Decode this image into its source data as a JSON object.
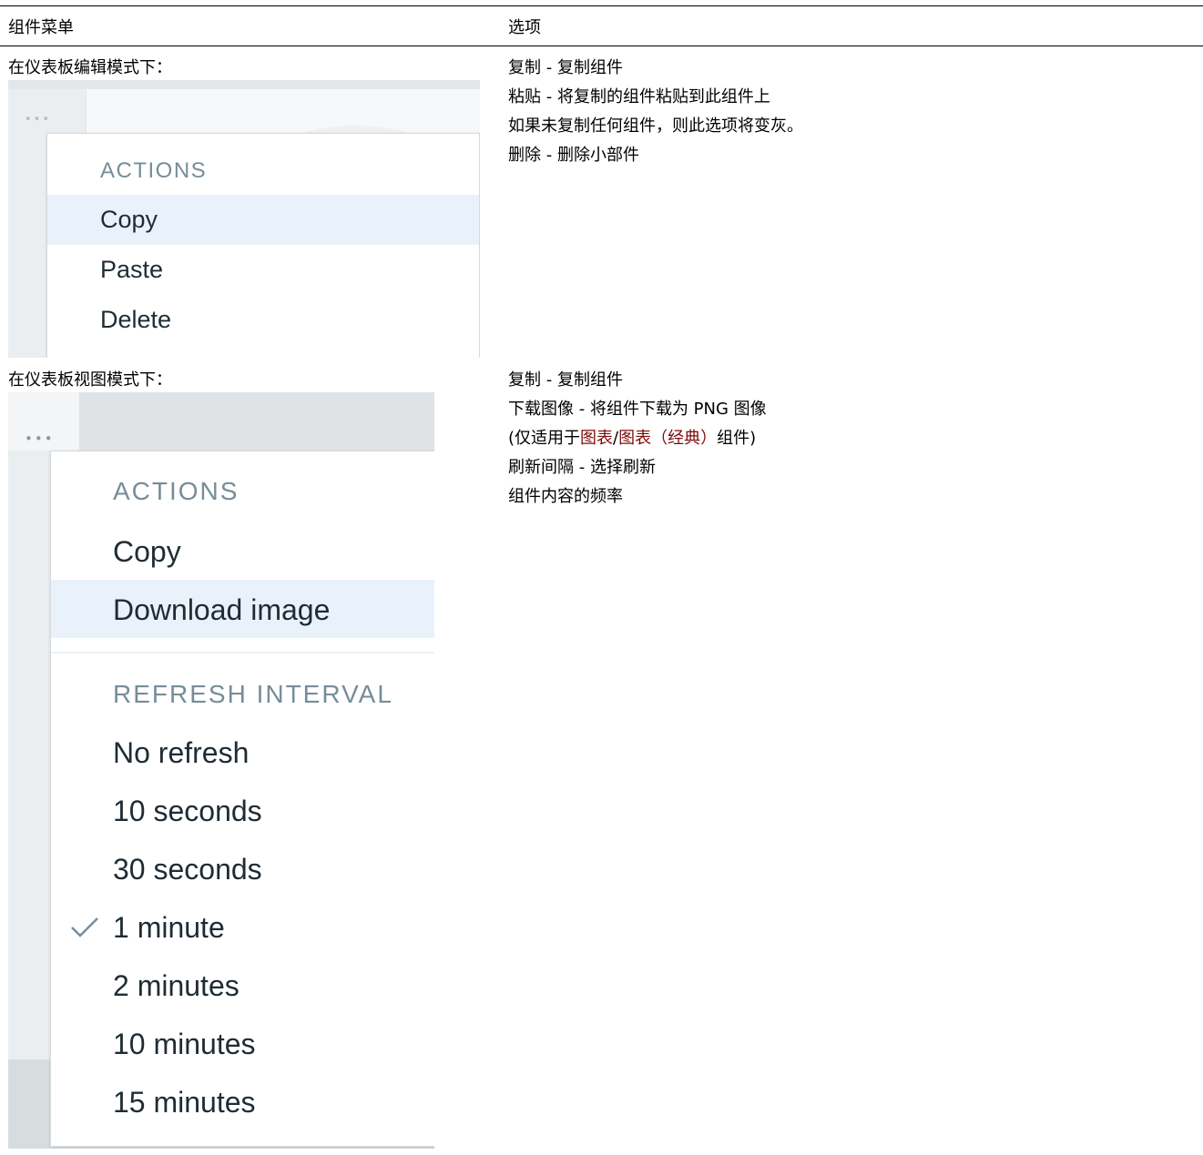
{
  "table": {
    "header": {
      "col1": "组件菜单",
      "col2": "选项"
    },
    "rows": [
      {
        "mode_label": "在仪表板编辑模式下：",
        "options": [
          "复制 - 复制组件",
          "粘贴 - 将复制的组件粘贴到此组件上",
          "如果未复制任何组件，则此选项将变灰。",
          "删除 - 删除小部件"
        ]
      },
      {
        "mode_label": "在仪表板视图模式下：",
        "options_line1": "复制 - 复制组件",
        "options_line2": "下载图像 - 将组件下载为 PNG 图像",
        "options_line3_prefix": "(仅适用于",
        "options_line3_link1": "图表",
        "options_line3_sep": "/",
        "options_line3_link2": "图表（经典）",
        "options_line3_suffix": "组件)",
        "options_line4": "刷新间隔 - 选择刷新",
        "options_line5": "组件内容的频率"
      }
    ]
  },
  "edit_menu": {
    "dots": "•••",
    "heading": "ACTIONS",
    "items": [
      "Copy",
      "Paste",
      "Delete"
    ],
    "highlighted": "Copy"
  },
  "view_menu": {
    "dots": "•••",
    "actions_heading": "ACTIONS",
    "actions": [
      "Copy",
      "Download image"
    ],
    "highlighted": "Download image",
    "refresh_heading": "REFRESH INTERVAL",
    "refresh_items": [
      "No refresh",
      "10 seconds",
      "30 seconds",
      "1 minute",
      "2 minutes",
      "10 minutes",
      "15 minutes"
    ],
    "selected_refresh": "1 minute",
    "check_icon": "check-icon"
  },
  "colors": {
    "link": "#7f0a0a",
    "menu_highlight": "#e9f2fb",
    "menu_heading": "#768d99",
    "menu_text": "#1f2c33"
  }
}
